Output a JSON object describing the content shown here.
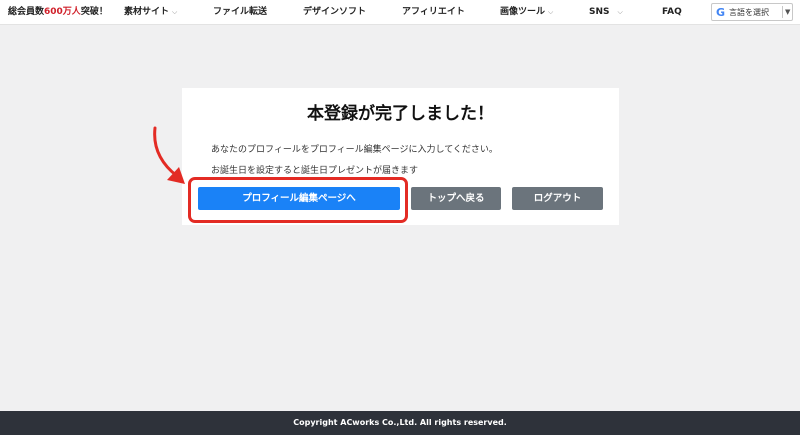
{
  "header": {
    "member_count_prefix": "総会員数",
    "member_count_number": "600万人",
    "member_count_suffix": "突破！",
    "nav": [
      {
        "label": "素材サイト",
        "has_dropdown": true
      },
      {
        "label": "ファイル転送",
        "has_dropdown": false
      },
      {
        "label": "デザインソフト",
        "has_dropdown": false
      },
      {
        "label": "アフィリエイト",
        "has_dropdown": false
      },
      {
        "label": "画像ツール",
        "has_dropdown": true
      },
      {
        "label": "SNS",
        "has_dropdown": true
      },
      {
        "label": "FAQ",
        "has_dropdown": false
      }
    ],
    "translate": {
      "icon": "google-g-icon",
      "label": "言語を選択",
      "arrow": "▼"
    }
  },
  "card": {
    "title": "本登録が完了しました！",
    "message_1": "あなたのプロフィールをプロフィール編集ページに入力してください。",
    "message_2": "お誕生日を設定すると誕生日プレゼントが届きます",
    "buttons": {
      "profile_edit": "プロフィール編集ページへ",
      "back_to_top": "トップへ戻る",
      "logout": "ログアウト"
    }
  },
  "footer": {
    "copyright": "Copyright ACworks Co.,Ltd. All rights reserved."
  },
  "colors": {
    "accent": "#1a82f7",
    "secondary_button": "#6b747c",
    "highlight": "#e32b24",
    "footer_bg": "#2e323a",
    "page_bg": "#f0f0f1"
  }
}
